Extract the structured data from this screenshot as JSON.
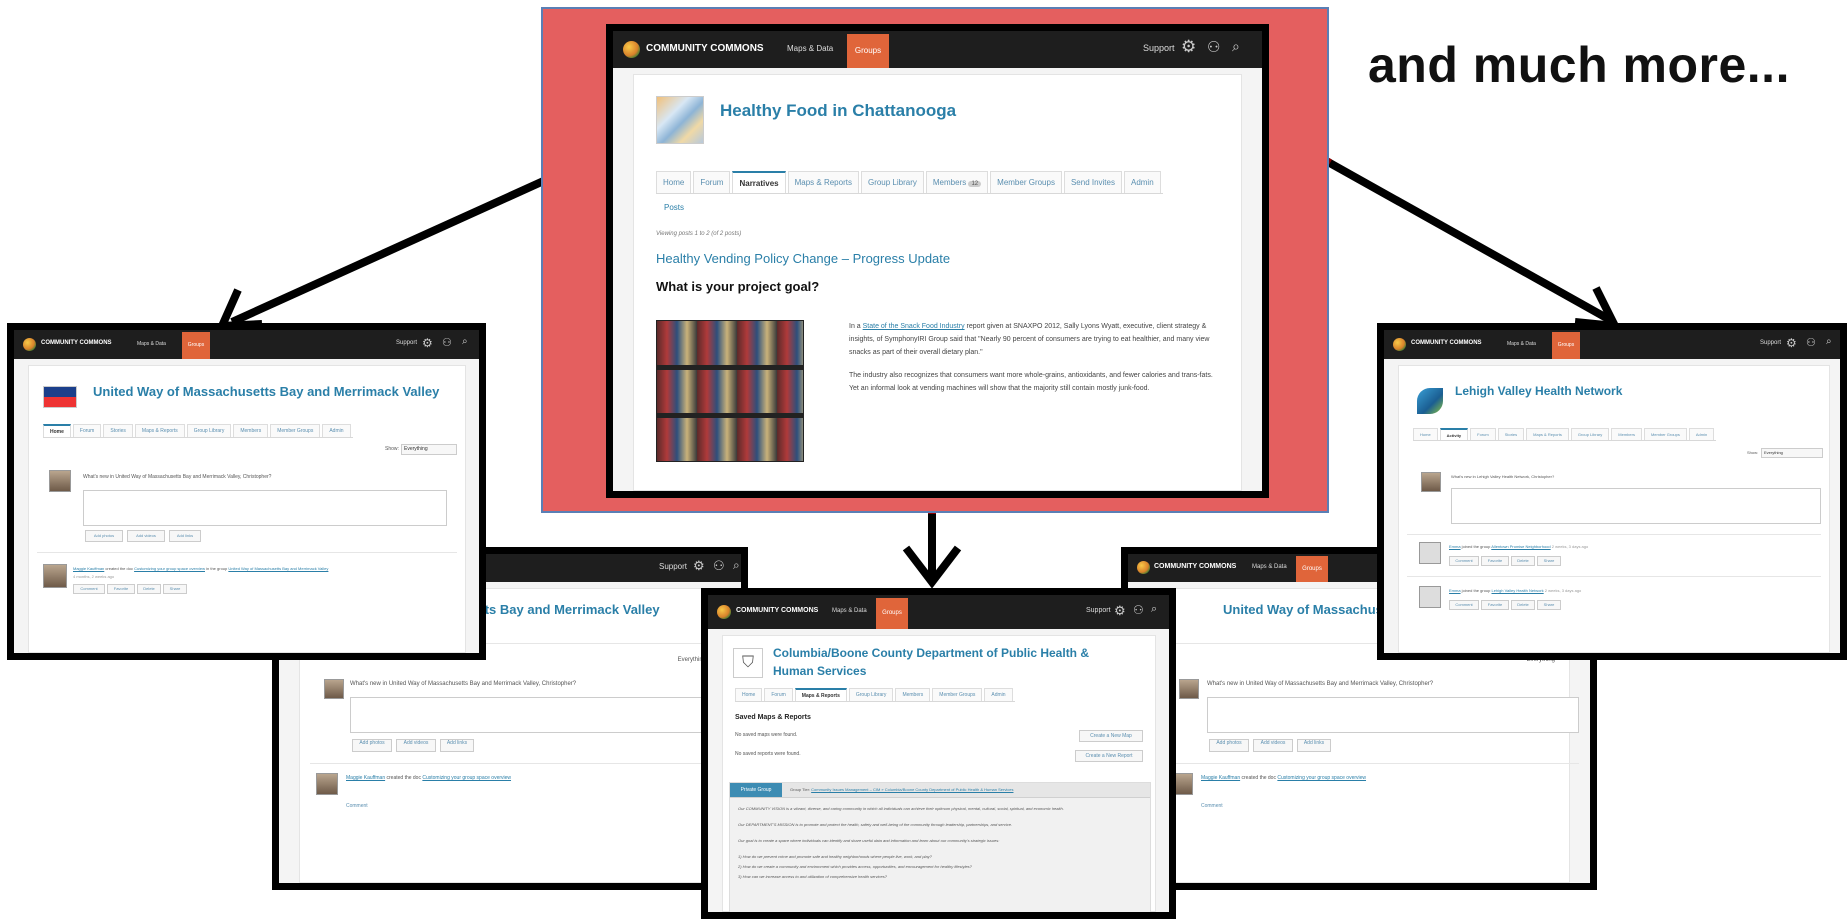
{
  "headline": "and much more...",
  "brand": "COMMUNITY COMMONS",
  "nav": {
    "maps": "Maps & Data",
    "groups": "Groups",
    "support": "Support"
  },
  "main": {
    "title": "Healthy Food in Chattanooga",
    "tabs": [
      "Home",
      "Forum",
      "Narratives",
      "Maps & Reports",
      "Group Library",
      "Members",
      "Member Groups",
      "Send Invites",
      "Admin"
    ],
    "members_count": "12",
    "subtab": "Posts",
    "viewing": "Viewing posts 1 to 2 (of 2 posts)",
    "post_title": "Healthy Vending Policy Change – Progress Update",
    "question": "What is your project goal?",
    "para1_pre": "In a ",
    "para1_link": "State of the Snack Food Industry",
    "para1_post": " report given at SNAXPO 2012, Sally Lyons Wyatt, executive, client strategy & insights, of SymphonyIRI Group said that \"Nearly 90 percent of consumers are trying to eat healthier, and many view snacks as part of their overall dietary plan.\"",
    "para2": "The industry also recognizes that consumers want more whole-grains, antioxidants, and fewer calories and trans-fats. Yet an informal look at vending machines will show that the majority still contain mostly junk-food."
  },
  "left": {
    "title": "United Way of Massachusetts Bay and Merrimack Valley",
    "tabs": [
      "Home",
      "Forum",
      "Stories",
      "Maps & Reports",
      "Group Library",
      "Members",
      "Member Groups",
      "Admin"
    ],
    "show_label": "Show:",
    "show_value": "Everything",
    "prompt": "What's new in United Way of Massachusetts Bay and Merrimack Valley, Christopher?",
    "buttons": [
      "Add photos",
      "Add videos",
      "Add links"
    ],
    "activity_pre": "Maggie Kauffman",
    "activity_mid": " created the doc ",
    "activity_link": "Customizing your group space overview",
    "activity_post": " in the group ",
    "activity_group": "United Way of Massachusetts Bay and Merrimack Valley",
    "activity_time": "4 months, 2 weeks ago",
    "actions": [
      "Comment",
      "Favorite",
      "Delete",
      "Share"
    ]
  },
  "right": {
    "title": "Lehigh Valley Health Network",
    "tabs": [
      "Home",
      "Activity",
      "Forum",
      "Stories",
      "Maps & Reports",
      "Group Library",
      "Members",
      "Member Groups",
      "Admin"
    ],
    "show_label": "Show:",
    "show_value": "Everything",
    "prompt": "What's new in Lehigh Valley Health Network, Christopher?",
    "act1_user": "Emma",
    "act1_text": " joined the group ",
    "act1_group": "Allentown Promise Neighborhood",
    "act1_time": "2 weeks, 3 days ago",
    "act2_user": "Emma",
    "act2_text": " joined the group ",
    "act2_group": "Lehigh Valley Health Network",
    "act2_time": "2 weeks, 3 days ago",
    "actions": [
      "Comment",
      "Favorite",
      "Delete",
      "Share"
    ]
  },
  "bl": {
    "title": "usetts Bay and Merrimack Valley"
  },
  "br": {
    "title": "United Way of Massachusetts B"
  },
  "center": {
    "title_line1": "Columbia/Boone County Department of Public Health &",
    "title_line2": "Human Services",
    "tabs": [
      "Home",
      "Forum",
      "Maps & Reports",
      "Group Library",
      "Members",
      "Member Groups",
      "Admin"
    ],
    "heading": "Saved Maps & Reports",
    "no_maps": "No saved maps were found.",
    "no_reports": "No saved reports were found.",
    "btn_map": "Create a New Map",
    "btn_report": "Create a New Report",
    "private": "Private Group",
    "group_tier": "Group Tier:",
    "tier_link": "Community Issues Management – CIM » Columbia/Boone County Department of Public Health & Human Services",
    "mission1": "Our COMMUNITY VISION is a vibrant, diverse, and caring community in which all individuals can achieve their optimum physical, mental, cultural, social, spiritual, and economic health.",
    "mission2": "Our DEPARTMENT'S MISSION is to promote and protect the health, safety and well-being of the community through leadership, partnerships, and service.",
    "mission3": "Our goal is to create a space where individuals can identify and share useful data and information and learn about our community's strategic issues:",
    "q1": "1) How do we prevent crime and promote safe and healthy neighborhoods where people live, work, and play?",
    "q2": "2) How do we create a community and environment which provides access, opportunities, and encouragement for healthy lifestyles?",
    "q3": "3) How can we increase access to and utilization of comprehensive health services?"
  }
}
